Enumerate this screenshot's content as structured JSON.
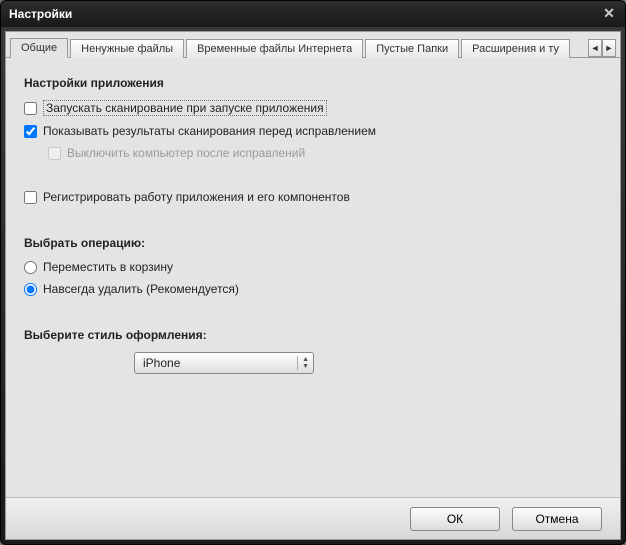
{
  "window": {
    "title": "Настройки"
  },
  "tabs": {
    "items": [
      {
        "label": "Общие"
      },
      {
        "label": "Ненужные файлы"
      },
      {
        "label": "Временные файлы Интернета"
      },
      {
        "label": "Пустые Папки"
      },
      {
        "label": "Расширения и ту"
      }
    ]
  },
  "sections": {
    "app": {
      "title": "Настройки приложения",
      "scan_on_start": "Запускать сканирование при запуске приложения",
      "show_results": "Показывать результаты сканирования перед исправлением",
      "shutdown_after": "Выключить компьютер после исправлений",
      "log_work": "Регистрировать работу приложения и его компонентов"
    },
    "operation": {
      "title": "Выбрать операцию:",
      "move_trash": "Переместить в корзину",
      "delete_forever": "Навсегда удалить (Рекомендуется)"
    },
    "style": {
      "title": "Выберите стиль оформления:",
      "selected": "iPhone"
    }
  },
  "footer": {
    "ok": "ОК",
    "cancel": "Отмена"
  }
}
